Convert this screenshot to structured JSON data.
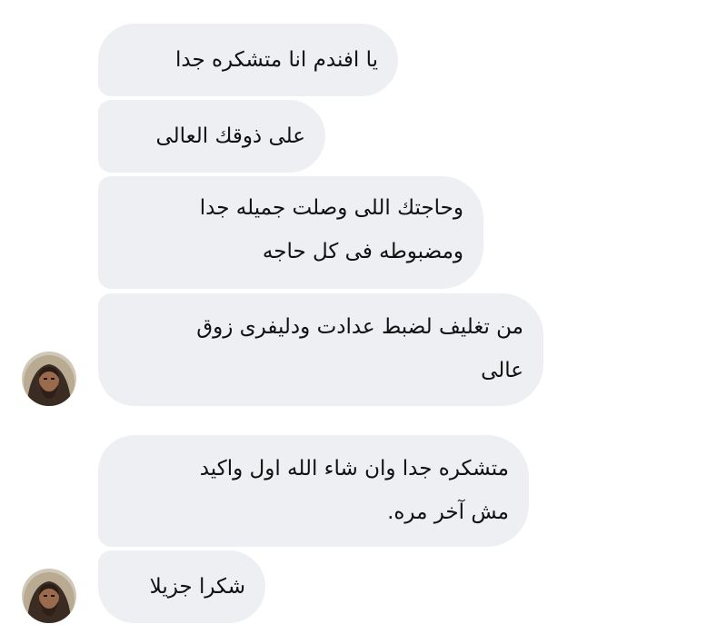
{
  "conversation": {
    "messages": [
      {
        "lines": [
          "يا افندم انا متشكره جدا"
        ]
      },
      {
        "lines": [
          "على ذوقك العالى"
        ]
      },
      {
        "lines": [
          "وحاجتك اللى وصلت جميله جدا",
          "ومضبوطه فى كل حاجه"
        ]
      },
      {
        "lines": [
          "من تغليف لضبط عدادت ودليفرى زوق",
          "عالى"
        ]
      },
      {
        "lines": [
          "متشكره جدا وان شاء الله اول واكيد",
          "مش آخر مره."
        ]
      },
      {
        "lines": [
          "شكرا جزيلا"
        ]
      }
    ],
    "avatar_icon": "user-portrait-icon",
    "colors": {
      "bubble_background": "#eeeff2",
      "text": "#111111",
      "page_background": "#ffffff"
    }
  }
}
